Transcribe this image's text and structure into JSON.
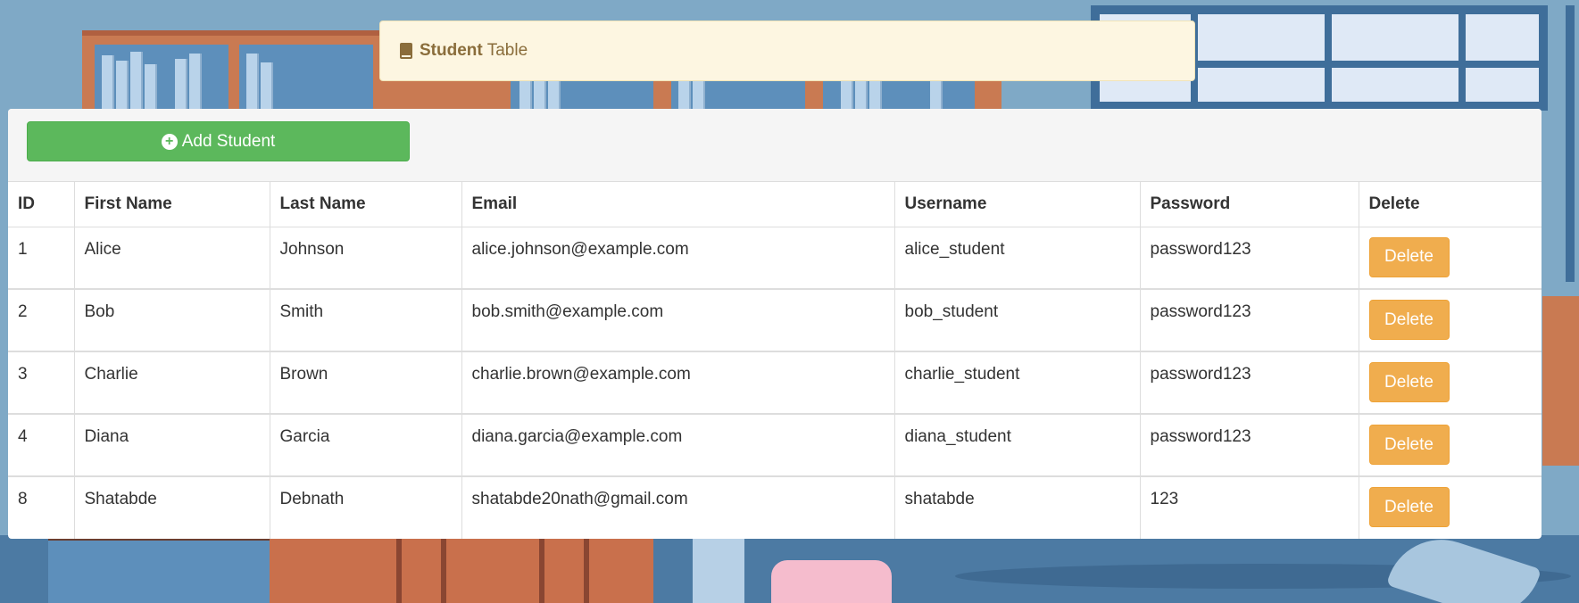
{
  "heading": {
    "bold": "Student",
    "rest": "Table"
  },
  "toolbar": {
    "add_label": "Add Student"
  },
  "table": {
    "headers": [
      "ID",
      "First Name",
      "Last Name",
      "Email",
      "Username",
      "Password",
      "Delete"
    ],
    "rows": [
      {
        "id": "1",
        "first": "Alice",
        "last": "Johnson",
        "email": "alice.johnson@example.com",
        "username": "alice_student",
        "password": "password123",
        "delete": "Delete"
      },
      {
        "id": "2",
        "first": "Bob",
        "last": "Smith",
        "email": "bob.smith@example.com",
        "username": "bob_student",
        "password": "password123",
        "delete": "Delete"
      },
      {
        "id": "3",
        "first": "Charlie",
        "last": "Brown",
        "email": "charlie.brown@example.com",
        "username": "charlie_student",
        "password": "password123",
        "delete": "Delete"
      },
      {
        "id": "4",
        "first": "Diana",
        "last": "Garcia",
        "email": "diana.garcia@example.com",
        "username": "diana_student",
        "password": "password123",
        "delete": "Delete"
      },
      {
        "id": "8",
        "first": "Shatabde",
        "last": "Debnath",
        "email": "shatabde20nath@gmail.com",
        "username": "shatabde",
        "password": "123",
        "delete": "Delete"
      }
    ]
  },
  "colors": {
    "add_button": "#5cb85c",
    "delete_button": "#f0ad4e",
    "heading_bg": "#fdf6e1",
    "heading_text": "#8a6d3b"
  },
  "icons": {
    "heading": "book-icon",
    "add": "plus-circle-icon"
  }
}
